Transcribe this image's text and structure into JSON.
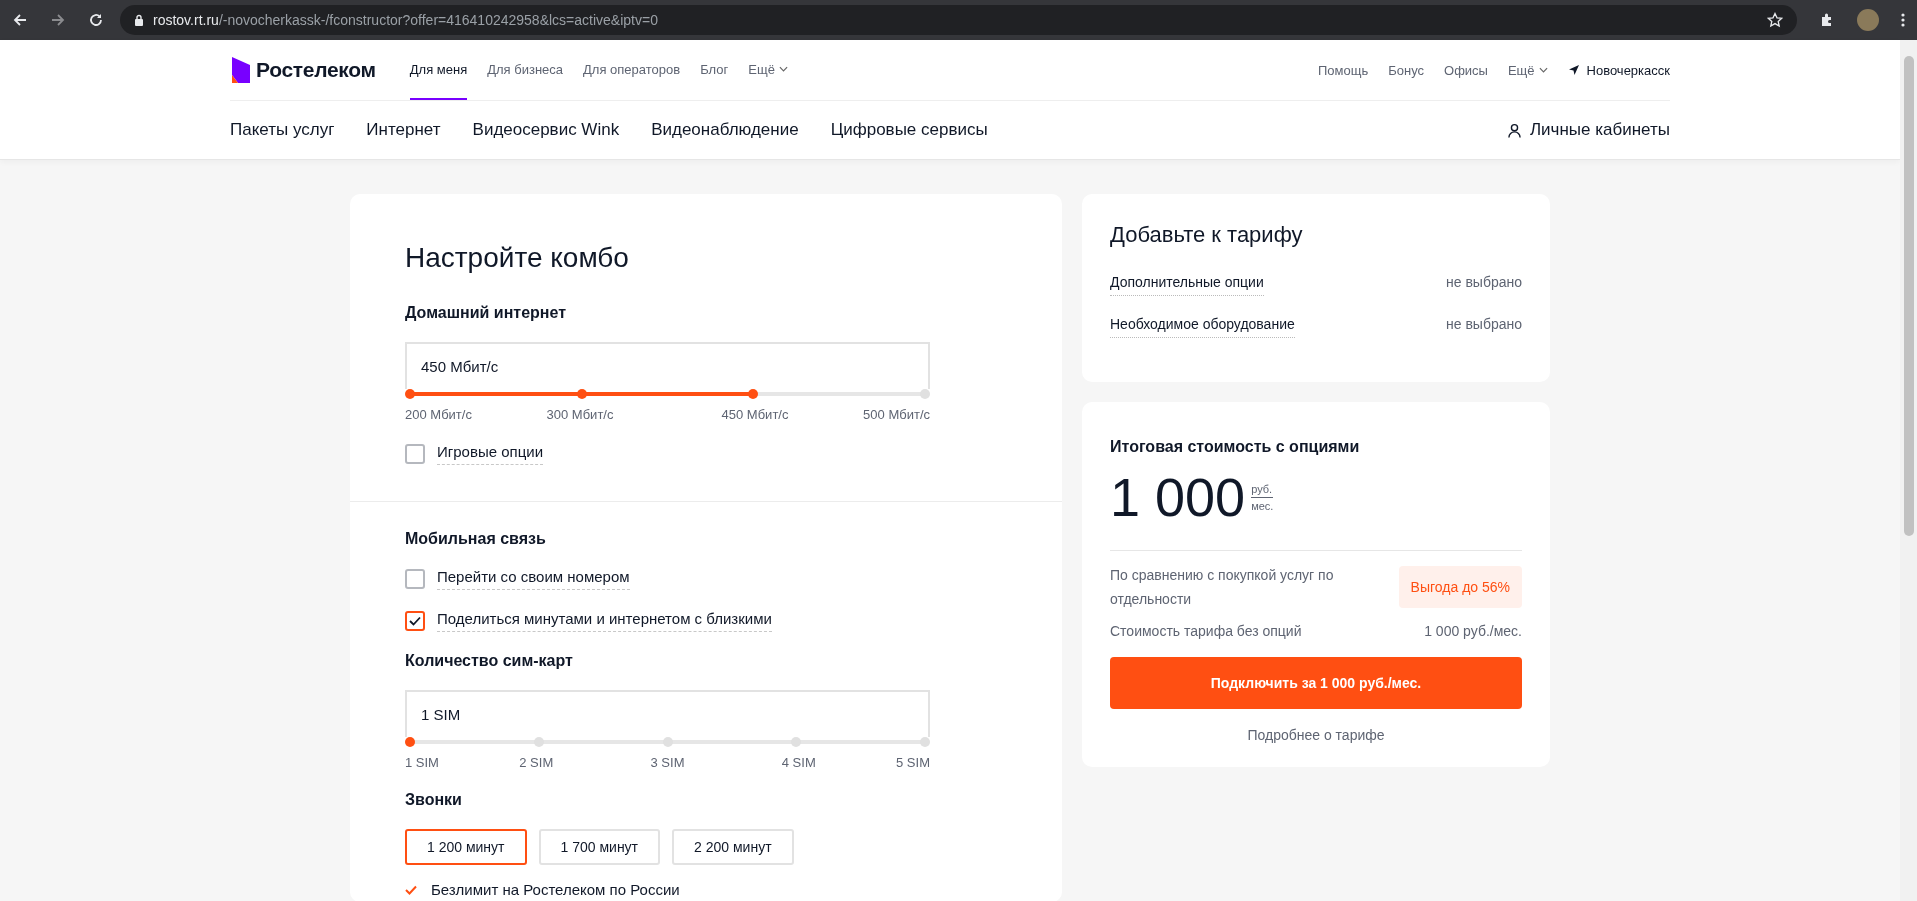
{
  "browser": {
    "url_host": "rostov.rt.ru",
    "url_path": "/-novocherkassk-/fconstructor?offer=416410242958&lcs=active&iptv=0"
  },
  "header": {
    "brand": "Ростелеком",
    "segments": [
      {
        "label": "Для меня",
        "selected": true,
        "dropdown": false
      },
      {
        "label": "Для бизнеса",
        "selected": false,
        "dropdown": false
      },
      {
        "label": "Для операторов",
        "selected": false,
        "dropdown": false
      },
      {
        "label": "Блог",
        "selected": false,
        "dropdown": false
      },
      {
        "label": "Ещё",
        "selected": false,
        "dropdown": true
      }
    ],
    "utility_links": [
      {
        "label": "Помощь",
        "dropdown": false
      },
      {
        "label": "Бонус",
        "dropdown": false
      },
      {
        "label": "Офисы",
        "dropdown": false
      },
      {
        "label": "Ещё",
        "dropdown": true
      }
    ],
    "city": "Новочеркасск",
    "main_nav": [
      "Пакеты услуг",
      "Интернет",
      "Видеосервис Wink",
      "Видеонаблюдение",
      "Цифровые сервисы"
    ],
    "account": "Личные кабинеты"
  },
  "configurator": {
    "title": "Настройте комбо",
    "sections": [
      {
        "items": [
          {
            "kind": "heading",
            "text": "Домашний интернет"
          },
          {
            "kind": "slider",
            "value": "450 Мбит/с",
            "level": 0.6667,
            "ticks": [
              "200 Мбит/с",
              "300 Мбит/с",
              "450 Мбит/с",
              "500 Мбит/с"
            ]
          },
          {
            "kind": "checkbox",
            "label": "Игровые опции",
            "checked": false
          }
        ]
      },
      {
        "items": [
          {
            "kind": "heading",
            "text": "Мобильная связь"
          },
          {
            "kind": "checkbox",
            "label": "Перейти со своим номером",
            "checked": false
          },
          {
            "kind": "checkbox",
            "label": "Поделиться минутами и интернетом с близкими",
            "checked": true
          },
          {
            "kind": "heading",
            "text": "Количество сим-карт"
          },
          {
            "kind": "slider",
            "value": "1 SIM",
            "level": 0,
            "ticks": [
              "1 SIM",
              "2 SIM",
              "3 SIM",
              "4 SIM",
              "5 SIM"
            ]
          },
          {
            "kind": "heading",
            "text": "Звонки"
          },
          {
            "kind": "choices",
            "options": [
              {
                "label": "1 200 минут",
                "selected": true
              },
              {
                "label": "1 700 минут",
                "selected": false
              },
              {
                "label": "2 200 минут",
                "selected": false
              }
            ]
          },
          {
            "kind": "feature",
            "text": "Безлимит на Ростелеком по России"
          }
        ]
      }
    ]
  },
  "addons": {
    "title": "Добавьте к тарифу",
    "rows": [
      {
        "label": "Дополнительные опции",
        "value": "не выбрано"
      },
      {
        "label": "Необходимое оборудование",
        "value": "не выбрано"
      }
    ]
  },
  "total": {
    "title": "Итоговая стоимость с опциями",
    "price": "1 000",
    "unit_top": "руб.",
    "unit_bottom": "мес.",
    "comparison": "По сравнению с покупкой услуг по отдельности",
    "badge": "Выгода до 56%",
    "base_label": "Стоимость тарифа без опций",
    "base_value": "1 000 руб./мес.",
    "cta": "Подключить за 1 000 руб./мес.",
    "details_link": "Подробнее о тарифе"
  }
}
